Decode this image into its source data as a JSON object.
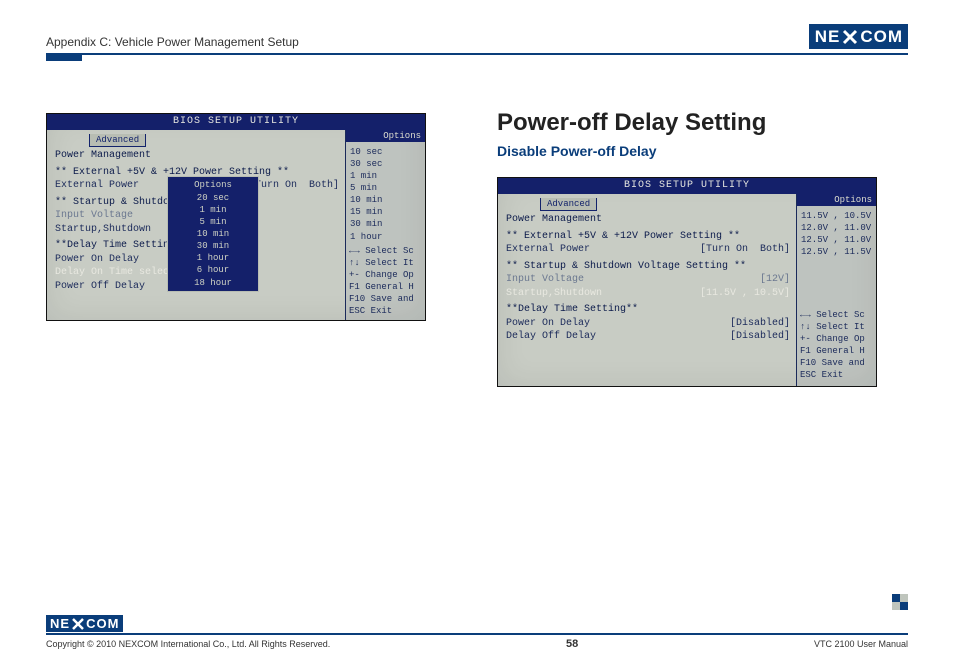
{
  "header": {
    "appendix": "Appendix C: Vehicle Power Management Setup",
    "brand_left": "NE",
    "brand_right": "COM"
  },
  "section": {
    "title": "Power-off Delay Setting",
    "subtitle": "Disable Power-off Delay"
  },
  "bios_left": {
    "title": "BIOS SETUP UTILITY",
    "tab": "Advanced",
    "panel_heading": "Power Management",
    "side_head": "Options",
    "sec1_label": "** External +5V & +12V Power Setting **",
    "sec1_row1_k": "External Power",
    "sec1_row1_v": "[Turn On  Both]",
    "sec2_label": "** Startup & Shutdown Volta",
    "sec2_row1_k": "Input Voltage",
    "sec2_row2_k": "Startup,Shutdown",
    "sec3_label": "**Delay Time Setting**",
    "sec3_row1_k": "Power On Delay",
    "sec3_row2_k": "Delay On Time selection",
    "sec3_row3_k": "Power Off Delay",
    "popup_head": "Options",
    "popup_opts": [
      "20 sec",
      "1 min",
      "5 min",
      "10 min",
      "30 min",
      "1 hour",
      "6 hour",
      "18 hour"
    ],
    "side_vals": [
      "10 sec",
      "30 sec",
      "1 min",
      "5 min",
      "10 min",
      "15 min",
      "30 min",
      "1 hour"
    ],
    "help": {
      "l1": "←→   Select Sc",
      "l2": "↑↓   Select It",
      "l3": "+-   Change Op",
      "l4": "F1   General H",
      "l5": "F10  Save and",
      "l6": "ESC  Exit"
    }
  },
  "bios_right": {
    "title": "BIOS SETUP UTILITY",
    "tab": "Advanced",
    "panel_heading": "Power Management",
    "side_head": "Options",
    "sec1_label": "** External +5V & +12V Power Setting **",
    "sec1_row1_k": "External Power",
    "sec1_row1_v": "[Turn On  Both]",
    "sec2_label": "** Startup & Shutdown Voltage Setting **",
    "sec2_row1_k": "Input Voltage",
    "sec2_row1_v": "[12V]",
    "sec2_row2_k": "Startup,Shutdown",
    "sec2_row2_v": "[11.5V , 10.5V]",
    "sec3_label": "**Delay Time Setting**",
    "sec3_row1_k": "Power On Delay",
    "sec3_row1_v": "[Disabled]",
    "sec3_row2_k": "Delay Off Delay",
    "sec3_row2_v": "[Disabled]",
    "side_vals": [
      "11.5V , 10.5V",
      "12.0V , 11.0V",
      "12.5V , 11.0V",
      "12.5V , 11.5V"
    ],
    "help": {
      "l1": "←→   Select Sc",
      "l2": "↑↓   Select It",
      "l3": "+-   Change Op",
      "l4": "F1   General H",
      "l5": "F10  Save and",
      "l6": "ESC  Exit"
    }
  },
  "footer": {
    "copyright": "Copyright © 2010 NEXCOM International Co., Ltd. All Rights Reserved.",
    "page": "58",
    "manual": "VTC 2100 User Manual"
  }
}
